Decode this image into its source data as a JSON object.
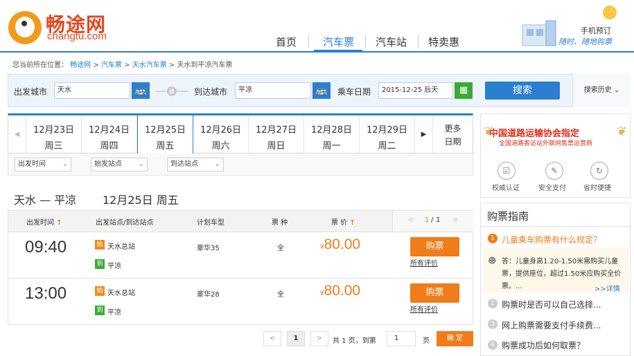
{
  "header": {
    "logo_cn": "畅途网",
    "logo_en": "changtu.com",
    "nav": [
      "首页",
      "汽车票",
      "汽车站",
      "特卖惠"
    ],
    "mobile_line1": "手机预订",
    "mobile_line2": "随时、随地购票"
  },
  "breadcrumb": {
    "prefix": "您当前所在位置：",
    "items": [
      "畅途网",
      "汽车票",
      "天水汽车票",
      "天水到平凉汽车票"
    ],
    "sep": " > "
  },
  "search": {
    "from_label": "出发城市",
    "from_value": "天水",
    "swap_label": "换",
    "to_label": "到达城市",
    "to_value": "平凉",
    "date_label": "乘车日期",
    "date_value": "2015-12-25  后天",
    "search_button": "搜索",
    "history": "搜索历史"
  },
  "dates": [
    {
      "date": "12月23日",
      "week": "周三"
    },
    {
      "date": "12月24日",
      "week": "周四"
    },
    {
      "date": "12月25日",
      "week": "周五",
      "active": true
    },
    {
      "date": "12月26日",
      "week": "周六"
    },
    {
      "date": "12月27日",
      "week": "周日"
    },
    {
      "date": "12月28日",
      "week": "周一"
    },
    {
      "date": "12月29日",
      "week": "周二"
    }
  ],
  "more_dates": [
    "更多",
    "日期"
  ],
  "filters": [
    "出发时间",
    "始发站点",
    "到达站点"
  ],
  "route": {
    "title": "天水 — 平凉",
    "date": "12月25日    周五"
  },
  "table": {
    "headers": [
      "出发时间",
      "出发站点/到达站点",
      "计划车型",
      "票 种",
      "票 价"
    ],
    "page_current": "1",
    "page_total": "1",
    "rows": [
      {
        "time": "09:40",
        "from_badge": "始",
        "from": "天水总站",
        "to_badge": "到",
        "to": "平凉",
        "bus": "豪华35",
        "kind": "全",
        "currency": "¥",
        "price": "80.00",
        "buy": "购票",
        "reviews": "所有评价"
      },
      {
        "time": "13:00",
        "from_badge": "始",
        "from": "天水总站",
        "to_badge": "到",
        "to": "平凉",
        "bus": "豪华28",
        "kind": "全",
        "currency": "¥",
        "price": "80.00",
        "buy": "购票",
        "reviews": "所有评价"
      }
    ]
  },
  "pager": {
    "page": "1",
    "summary": "共 1 页，到第",
    "input": "1",
    "unit": "页",
    "confirm": "确 定"
  },
  "sidebar": {
    "assoc_line1": "中国道路运输协会指定",
    "assoc_line2": "全国道路客运站外联网售票运营商",
    "features": [
      "权威认证",
      "安全支付",
      "省时便捷"
    ],
    "guide_title": "购票指南",
    "questions": [
      {
        "num": "1",
        "text": "儿童乘车购票有什么规定？"
      },
      {
        "num": "2",
        "text": "购票时是否可以自己选择..."
      },
      {
        "num": "3",
        "text": "网上购票需要支付手续费..."
      },
      {
        "num": "4",
        "text": "购票成功后如何取票？"
      }
    ],
    "answer": "答：儿童身高1.20-1.50米需购买儿童票，提供座位，超过1.50米应购买全价票。...",
    "detail": ">>详情"
  },
  "colors": {
    "accent": "#2a7fd0",
    "orange": "#f07c1a",
    "green": "#3aaa35",
    "red": "#d9321d"
  }
}
